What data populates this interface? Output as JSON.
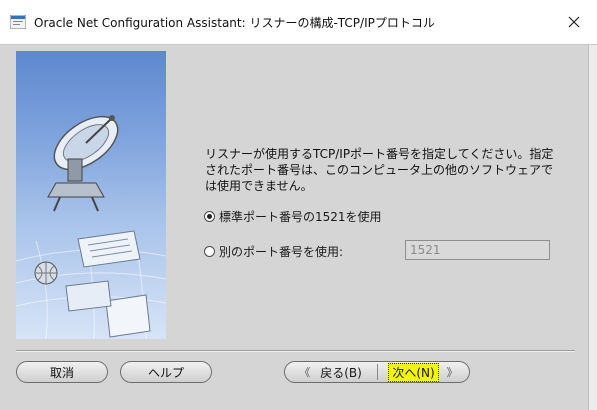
{
  "window": {
    "title": "Oracle Net Configuration Assistant: リスナーの構成-TCP/IPプロトコル",
    "close_icon": "close-icon"
  },
  "content": {
    "instruction_line1": "リスナーが使用するTCP/IPポート番号を指定してください。指定",
    "instruction_line2": "されたポート番号は、このコンピュータ上の他のソフトウェアで",
    "instruction_line3": "は使用できません。",
    "options": {
      "standard_port_label": "標準ポート番号の1521を使用",
      "standard_port_selected": true,
      "other_port_label": "別のポート番号を使用:",
      "other_port_selected": false
    },
    "port_field_value": "1521"
  },
  "buttons": {
    "cancel": "取消",
    "help": "ヘルプ",
    "back": "戻る(B)",
    "next": "次へ(N)"
  },
  "icons": {
    "side_graphic": "satellite-dish-icon",
    "back": "chevron-left-icon",
    "next": "chevron-right-icon"
  },
  "colors": {
    "highlight": "#f1f50a",
    "image_top": "#5d88cf",
    "image_bottom": "#d7e4f6"
  }
}
